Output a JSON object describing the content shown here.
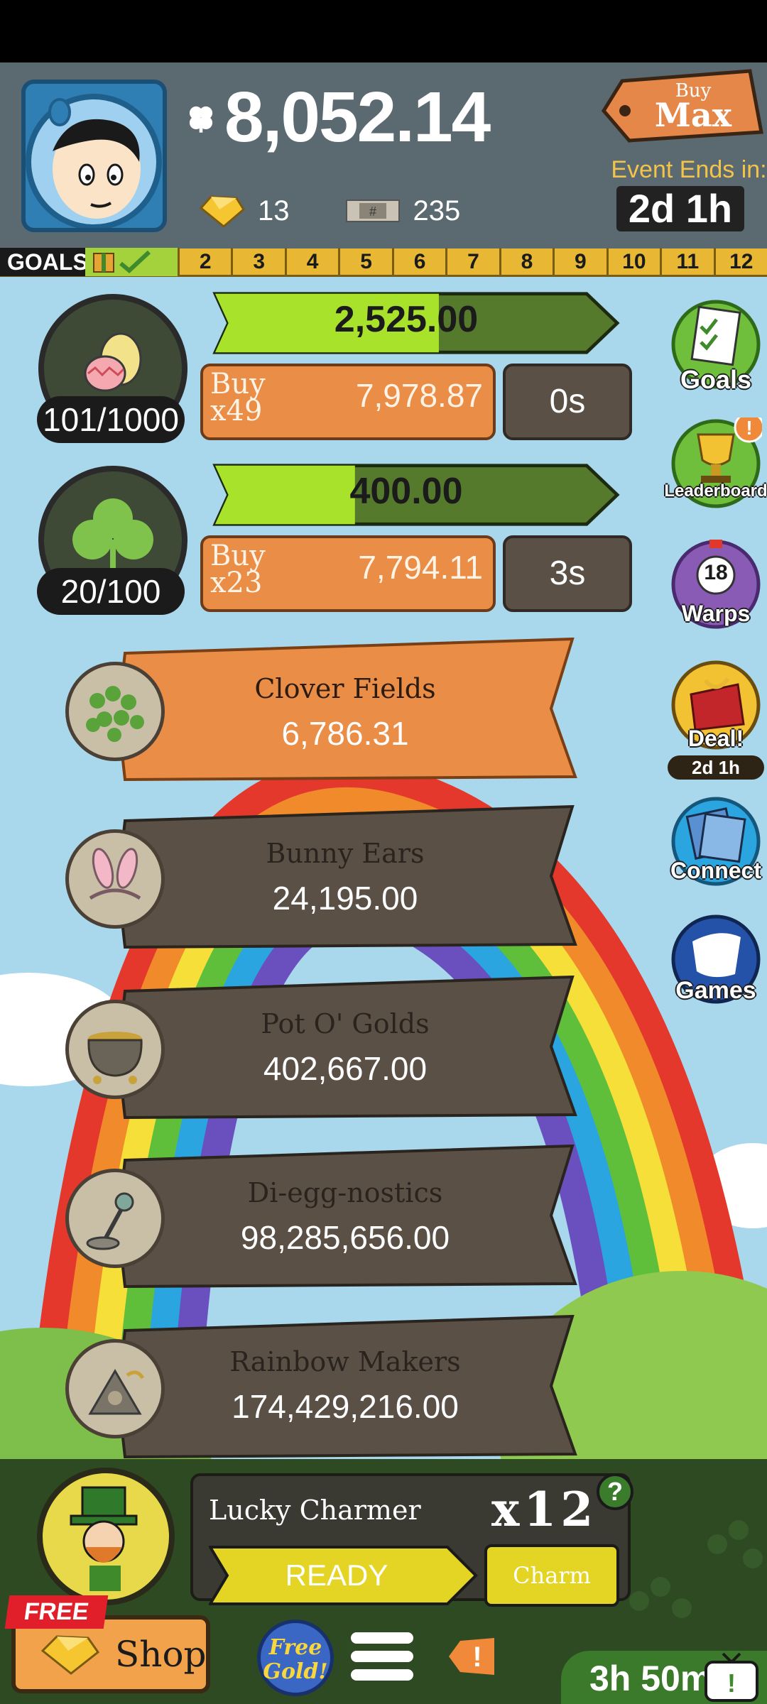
{
  "header": {
    "currency": "8,052.14",
    "gems": "13",
    "tickets": "235",
    "buy_max": {
      "top": "Buy",
      "bottom": "Max"
    },
    "event_label": "Event Ends in:",
    "event_timer": "2d 1h"
  },
  "goals": {
    "label": "GOALS",
    "numbers": [
      "2",
      "3",
      "4",
      "5",
      "6",
      "7",
      "8",
      "9",
      "10",
      "11",
      "12"
    ]
  },
  "producers": [
    {
      "progress_value": "2,525.00",
      "progress_fraction": 0.56,
      "manager_count": "101/1000",
      "buy_qty": "x49",
      "buy_cost": "7,978.87",
      "timer": "0s"
    },
    {
      "progress_value": "400.00",
      "progress_fraction": 0.35,
      "manager_count": "20/100",
      "buy_qty": "x23",
      "buy_cost": "7,794.11",
      "timer": "3s"
    }
  ],
  "buy_label": "Buy",
  "banners": [
    {
      "name": "Clover Fields",
      "value": "6,786.31",
      "active": true
    },
    {
      "name": "Bunny Ears",
      "value": "24,195.00",
      "active": false
    },
    {
      "name": "Pot O' Golds",
      "value": "402,667.00",
      "active": false
    },
    {
      "name": "Di-egg-nostics",
      "value": "98,285,656.00",
      "active": false
    },
    {
      "name": "Rainbow Makers",
      "value": "174,429,216.00",
      "active": false
    }
  ],
  "side_menu": {
    "goals": "Goals",
    "leaderboard": "Leaderboard",
    "warps": "Warps",
    "warps_count": "18",
    "deal": "Deal!",
    "deal_timer": "2d 1h",
    "connect": "Connect",
    "games": "Games"
  },
  "bottom": {
    "lucky_title": "Lucky Charmer",
    "multiplier": "x12",
    "help": "?",
    "ready": "READY",
    "charm": "Charm",
    "shop": "Shop",
    "free_tag": "FREE",
    "free_gold": [
      "Free",
      "Gold!"
    ],
    "timer": "3h 50m"
  },
  "colors": {
    "accent_orange": "#e98d47",
    "progress_green": "#a8e22a",
    "banner_dark": "#5a5045"
  }
}
